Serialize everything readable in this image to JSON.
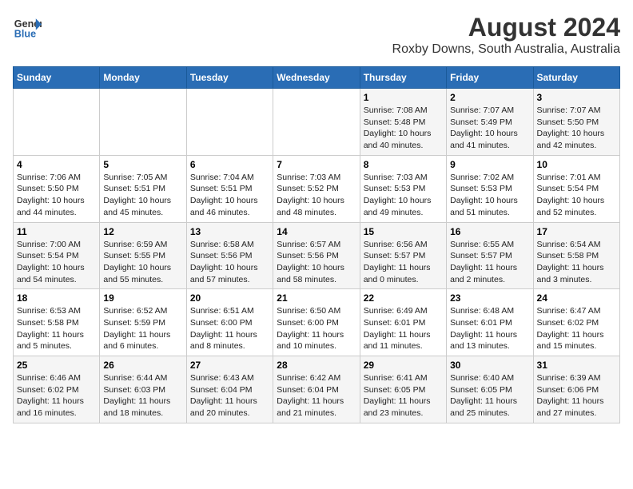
{
  "header": {
    "logo_line1": "General",
    "logo_line2": "Blue",
    "title": "August 2024",
    "subtitle": "Roxby Downs, South Australia, Australia"
  },
  "days_of_week": [
    "Sunday",
    "Monday",
    "Tuesday",
    "Wednesday",
    "Thursday",
    "Friday",
    "Saturday"
  ],
  "weeks": [
    [
      {
        "day": "",
        "info": ""
      },
      {
        "day": "",
        "info": ""
      },
      {
        "day": "",
        "info": ""
      },
      {
        "day": "",
        "info": ""
      },
      {
        "day": "1",
        "info": "Sunrise: 7:08 AM\nSunset: 5:48 PM\nDaylight: 10 hours\nand 40 minutes."
      },
      {
        "day": "2",
        "info": "Sunrise: 7:07 AM\nSunset: 5:49 PM\nDaylight: 10 hours\nand 41 minutes."
      },
      {
        "day": "3",
        "info": "Sunrise: 7:07 AM\nSunset: 5:50 PM\nDaylight: 10 hours\nand 42 minutes."
      }
    ],
    [
      {
        "day": "4",
        "info": "Sunrise: 7:06 AM\nSunset: 5:50 PM\nDaylight: 10 hours\nand 44 minutes."
      },
      {
        "day": "5",
        "info": "Sunrise: 7:05 AM\nSunset: 5:51 PM\nDaylight: 10 hours\nand 45 minutes."
      },
      {
        "day": "6",
        "info": "Sunrise: 7:04 AM\nSunset: 5:51 PM\nDaylight: 10 hours\nand 46 minutes."
      },
      {
        "day": "7",
        "info": "Sunrise: 7:03 AM\nSunset: 5:52 PM\nDaylight: 10 hours\nand 48 minutes."
      },
      {
        "day": "8",
        "info": "Sunrise: 7:03 AM\nSunset: 5:53 PM\nDaylight: 10 hours\nand 49 minutes."
      },
      {
        "day": "9",
        "info": "Sunrise: 7:02 AM\nSunset: 5:53 PM\nDaylight: 10 hours\nand 51 minutes."
      },
      {
        "day": "10",
        "info": "Sunrise: 7:01 AM\nSunset: 5:54 PM\nDaylight: 10 hours\nand 52 minutes."
      }
    ],
    [
      {
        "day": "11",
        "info": "Sunrise: 7:00 AM\nSunset: 5:54 PM\nDaylight: 10 hours\nand 54 minutes."
      },
      {
        "day": "12",
        "info": "Sunrise: 6:59 AM\nSunset: 5:55 PM\nDaylight: 10 hours\nand 55 minutes."
      },
      {
        "day": "13",
        "info": "Sunrise: 6:58 AM\nSunset: 5:56 PM\nDaylight: 10 hours\nand 57 minutes."
      },
      {
        "day": "14",
        "info": "Sunrise: 6:57 AM\nSunset: 5:56 PM\nDaylight: 10 hours\nand 58 minutes."
      },
      {
        "day": "15",
        "info": "Sunrise: 6:56 AM\nSunset: 5:57 PM\nDaylight: 11 hours\nand 0 minutes."
      },
      {
        "day": "16",
        "info": "Sunrise: 6:55 AM\nSunset: 5:57 PM\nDaylight: 11 hours\nand 2 minutes."
      },
      {
        "day": "17",
        "info": "Sunrise: 6:54 AM\nSunset: 5:58 PM\nDaylight: 11 hours\nand 3 minutes."
      }
    ],
    [
      {
        "day": "18",
        "info": "Sunrise: 6:53 AM\nSunset: 5:58 PM\nDaylight: 11 hours\nand 5 minutes."
      },
      {
        "day": "19",
        "info": "Sunrise: 6:52 AM\nSunset: 5:59 PM\nDaylight: 11 hours\nand 6 minutes."
      },
      {
        "day": "20",
        "info": "Sunrise: 6:51 AM\nSunset: 6:00 PM\nDaylight: 11 hours\nand 8 minutes."
      },
      {
        "day": "21",
        "info": "Sunrise: 6:50 AM\nSunset: 6:00 PM\nDaylight: 11 hours\nand 10 minutes."
      },
      {
        "day": "22",
        "info": "Sunrise: 6:49 AM\nSunset: 6:01 PM\nDaylight: 11 hours\nand 11 minutes."
      },
      {
        "day": "23",
        "info": "Sunrise: 6:48 AM\nSunset: 6:01 PM\nDaylight: 11 hours\nand 13 minutes."
      },
      {
        "day": "24",
        "info": "Sunrise: 6:47 AM\nSunset: 6:02 PM\nDaylight: 11 hours\nand 15 minutes."
      }
    ],
    [
      {
        "day": "25",
        "info": "Sunrise: 6:46 AM\nSunset: 6:02 PM\nDaylight: 11 hours\nand 16 minutes."
      },
      {
        "day": "26",
        "info": "Sunrise: 6:44 AM\nSunset: 6:03 PM\nDaylight: 11 hours\nand 18 minutes."
      },
      {
        "day": "27",
        "info": "Sunrise: 6:43 AM\nSunset: 6:04 PM\nDaylight: 11 hours\nand 20 minutes."
      },
      {
        "day": "28",
        "info": "Sunrise: 6:42 AM\nSunset: 6:04 PM\nDaylight: 11 hours\nand 21 minutes."
      },
      {
        "day": "29",
        "info": "Sunrise: 6:41 AM\nSunset: 6:05 PM\nDaylight: 11 hours\nand 23 minutes."
      },
      {
        "day": "30",
        "info": "Sunrise: 6:40 AM\nSunset: 6:05 PM\nDaylight: 11 hours\nand 25 minutes."
      },
      {
        "day": "31",
        "info": "Sunrise: 6:39 AM\nSunset: 6:06 PM\nDaylight: 11 hours\nand 27 minutes."
      }
    ]
  ]
}
